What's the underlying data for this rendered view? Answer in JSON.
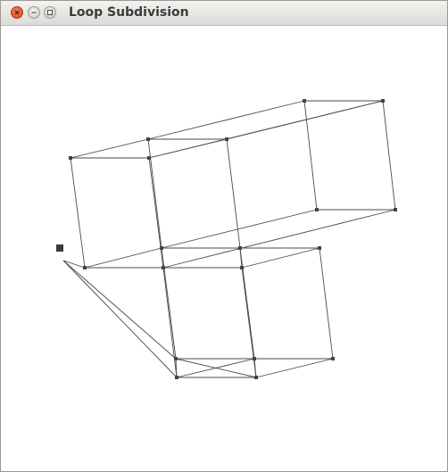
{
  "window": {
    "title": "Loop Subdivision"
  },
  "scene": {
    "edge_color": "#4a4a4a",
    "vertex_color": "#444444",
    "selected_vertex_color": "#3a3a3a"
  }
}
